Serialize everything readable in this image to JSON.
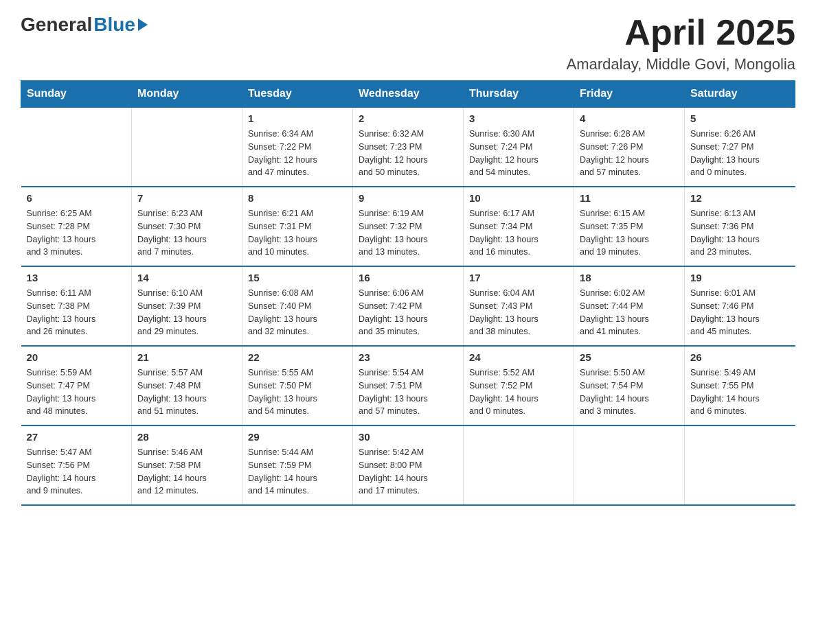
{
  "header": {
    "logo_general": "General",
    "logo_blue": "Blue",
    "title": "April 2025",
    "subtitle": "Amardalay, Middle Govi, Mongolia"
  },
  "calendar": {
    "days_of_week": [
      "Sunday",
      "Monday",
      "Tuesday",
      "Wednesday",
      "Thursday",
      "Friday",
      "Saturday"
    ],
    "weeks": [
      [
        {
          "day": "",
          "info": ""
        },
        {
          "day": "",
          "info": ""
        },
        {
          "day": "1",
          "info": "Sunrise: 6:34 AM\nSunset: 7:22 PM\nDaylight: 12 hours\nand 47 minutes."
        },
        {
          "day": "2",
          "info": "Sunrise: 6:32 AM\nSunset: 7:23 PM\nDaylight: 12 hours\nand 50 minutes."
        },
        {
          "day": "3",
          "info": "Sunrise: 6:30 AM\nSunset: 7:24 PM\nDaylight: 12 hours\nand 54 minutes."
        },
        {
          "day": "4",
          "info": "Sunrise: 6:28 AM\nSunset: 7:26 PM\nDaylight: 12 hours\nand 57 minutes."
        },
        {
          "day": "5",
          "info": "Sunrise: 6:26 AM\nSunset: 7:27 PM\nDaylight: 13 hours\nand 0 minutes."
        }
      ],
      [
        {
          "day": "6",
          "info": "Sunrise: 6:25 AM\nSunset: 7:28 PM\nDaylight: 13 hours\nand 3 minutes."
        },
        {
          "day": "7",
          "info": "Sunrise: 6:23 AM\nSunset: 7:30 PM\nDaylight: 13 hours\nand 7 minutes."
        },
        {
          "day": "8",
          "info": "Sunrise: 6:21 AM\nSunset: 7:31 PM\nDaylight: 13 hours\nand 10 minutes."
        },
        {
          "day": "9",
          "info": "Sunrise: 6:19 AM\nSunset: 7:32 PM\nDaylight: 13 hours\nand 13 minutes."
        },
        {
          "day": "10",
          "info": "Sunrise: 6:17 AM\nSunset: 7:34 PM\nDaylight: 13 hours\nand 16 minutes."
        },
        {
          "day": "11",
          "info": "Sunrise: 6:15 AM\nSunset: 7:35 PM\nDaylight: 13 hours\nand 19 minutes."
        },
        {
          "day": "12",
          "info": "Sunrise: 6:13 AM\nSunset: 7:36 PM\nDaylight: 13 hours\nand 23 minutes."
        }
      ],
      [
        {
          "day": "13",
          "info": "Sunrise: 6:11 AM\nSunset: 7:38 PM\nDaylight: 13 hours\nand 26 minutes."
        },
        {
          "day": "14",
          "info": "Sunrise: 6:10 AM\nSunset: 7:39 PM\nDaylight: 13 hours\nand 29 minutes."
        },
        {
          "day": "15",
          "info": "Sunrise: 6:08 AM\nSunset: 7:40 PM\nDaylight: 13 hours\nand 32 minutes."
        },
        {
          "day": "16",
          "info": "Sunrise: 6:06 AM\nSunset: 7:42 PM\nDaylight: 13 hours\nand 35 minutes."
        },
        {
          "day": "17",
          "info": "Sunrise: 6:04 AM\nSunset: 7:43 PM\nDaylight: 13 hours\nand 38 minutes."
        },
        {
          "day": "18",
          "info": "Sunrise: 6:02 AM\nSunset: 7:44 PM\nDaylight: 13 hours\nand 41 minutes."
        },
        {
          "day": "19",
          "info": "Sunrise: 6:01 AM\nSunset: 7:46 PM\nDaylight: 13 hours\nand 45 minutes."
        }
      ],
      [
        {
          "day": "20",
          "info": "Sunrise: 5:59 AM\nSunset: 7:47 PM\nDaylight: 13 hours\nand 48 minutes."
        },
        {
          "day": "21",
          "info": "Sunrise: 5:57 AM\nSunset: 7:48 PM\nDaylight: 13 hours\nand 51 minutes."
        },
        {
          "day": "22",
          "info": "Sunrise: 5:55 AM\nSunset: 7:50 PM\nDaylight: 13 hours\nand 54 minutes."
        },
        {
          "day": "23",
          "info": "Sunrise: 5:54 AM\nSunset: 7:51 PM\nDaylight: 13 hours\nand 57 minutes."
        },
        {
          "day": "24",
          "info": "Sunrise: 5:52 AM\nSunset: 7:52 PM\nDaylight: 14 hours\nand 0 minutes."
        },
        {
          "day": "25",
          "info": "Sunrise: 5:50 AM\nSunset: 7:54 PM\nDaylight: 14 hours\nand 3 minutes."
        },
        {
          "day": "26",
          "info": "Sunrise: 5:49 AM\nSunset: 7:55 PM\nDaylight: 14 hours\nand 6 minutes."
        }
      ],
      [
        {
          "day": "27",
          "info": "Sunrise: 5:47 AM\nSunset: 7:56 PM\nDaylight: 14 hours\nand 9 minutes."
        },
        {
          "day": "28",
          "info": "Sunrise: 5:46 AM\nSunset: 7:58 PM\nDaylight: 14 hours\nand 12 minutes."
        },
        {
          "day": "29",
          "info": "Sunrise: 5:44 AM\nSunset: 7:59 PM\nDaylight: 14 hours\nand 14 minutes."
        },
        {
          "day": "30",
          "info": "Sunrise: 5:42 AM\nSunset: 8:00 PM\nDaylight: 14 hours\nand 17 minutes."
        },
        {
          "day": "",
          "info": ""
        },
        {
          "day": "",
          "info": ""
        },
        {
          "day": "",
          "info": ""
        }
      ]
    ]
  }
}
